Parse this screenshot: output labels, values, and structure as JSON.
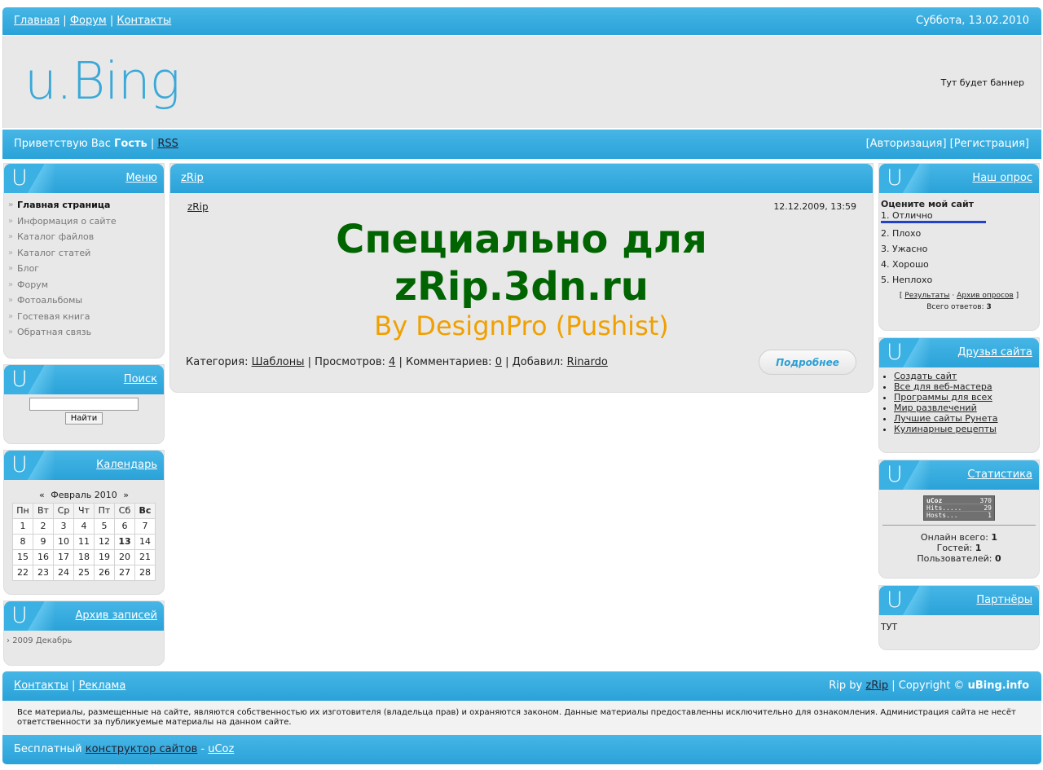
{
  "top_nav": {
    "links": [
      "Главная",
      "Форум",
      "Контакты"
    ],
    "date": "Суббота, 13.02.2010"
  },
  "header": {
    "logo": "u.Bing",
    "banner": "Тут будет баннер"
  },
  "user_bar": {
    "greeting": "Приветствую Вас",
    "user": "Гость",
    "rss": "RSS",
    "login": "[Авторизация]",
    "register": "[Регистрация]"
  },
  "left": {
    "menu": {
      "title": "Меню",
      "items": [
        "Главная страница",
        "Информация о сайте",
        "Каталог файлов",
        "Каталог статей",
        "Блог",
        "Форум",
        "Фотоальбомы",
        "Гостевая книга",
        "Обратная связь"
      ]
    },
    "search": {
      "title": "Поиск",
      "button": "Найти"
    },
    "calendar": {
      "title": "Календарь",
      "month": "Февраль 2010",
      "prev": "«",
      "next": "»",
      "days": [
        "Пн",
        "Вт",
        "Ср",
        "Чт",
        "Пт",
        "Сб",
        "Вс"
      ],
      "weeks": [
        [
          "1",
          "2",
          "3",
          "4",
          "5",
          "6",
          "7"
        ],
        [
          "8",
          "9",
          "10",
          "11",
          "12",
          "13",
          "14"
        ],
        [
          "15",
          "16",
          "17",
          "18",
          "19",
          "20",
          "21"
        ],
        [
          "22",
          "23",
          "24",
          "25",
          "26",
          "27",
          "28"
        ]
      ]
    },
    "archive": {
      "title": "Архив записей",
      "item": "2009 Декабрь"
    }
  },
  "main": {
    "title": "zRip",
    "post": {
      "author_link": "zRip",
      "date": "12.12.2009, 13:59",
      "headline1": "Специально для",
      "headline2": "zRip.3dn.ru",
      "byline": "By DesignPro (Pushist)",
      "cat_label": "Категория:",
      "cat": "Шаблоны",
      "views_label": "Просмотров:",
      "views": "4",
      "comments_label": "Комментариев:",
      "comments": "0",
      "added_label": "Добавил:",
      "added": "Rinardo",
      "more": "Подробнее"
    }
  },
  "right": {
    "poll": {
      "title": "Наш опрос",
      "question": "Оцените мой сайт",
      "options": [
        "1. Отлично",
        "2. Плохо",
        "3. Ужасно",
        "4. Хорошо",
        "5. Неплохо"
      ],
      "results": "Результаты",
      "archive": "Архив опросов",
      "total_label": "Всего ответов:",
      "total": "3"
    },
    "friends": {
      "title": "Друзья сайта",
      "items": [
        "Создать сайт",
        "Все для веб-мастера",
        "Программы для всех",
        "Мир развлечений",
        "Лучшие сайты Рунета",
        "Кулинарные рецепты"
      ]
    },
    "stats": {
      "title": "Статистика",
      "counter": [
        [
          "uCoz",
          "370"
        ],
        [
          "Hits.....",
          "29"
        ],
        [
          "Hosts...",
          "1"
        ]
      ],
      "online_label": "Онлайн всего:",
      "online": "1",
      "guests_label": "Гостей:",
      "guests": "1",
      "users_label": "Пользователей:",
      "users": "0"
    },
    "partners": {
      "title": "Партнёры",
      "text": "ТУТ"
    }
  },
  "footer": {
    "links": [
      "Контакты",
      "Реклама"
    ],
    "rip_by": "Rip by",
    "rip_link": "zRip",
    "copyright": "| Copyright ©",
    "brand": "uBing.info",
    "disclaimer": "Все материалы, размещенные на сайте, являются собственностью их изготовителя (владельца прав) и охраняются законом. Данные материалы предоставленны исключительно для ознакомления. Администрация сайта не несёт ответственности за публикуемые материалы на данном сайте.",
    "free": "Бесплатный",
    "builder": "конструктор сайтов",
    "dash": "-",
    "ucoz": "uCoz"
  },
  "colors": {
    "accent": "#2aa2d8",
    "headline": "#006400",
    "byline": "#f0a000"
  }
}
